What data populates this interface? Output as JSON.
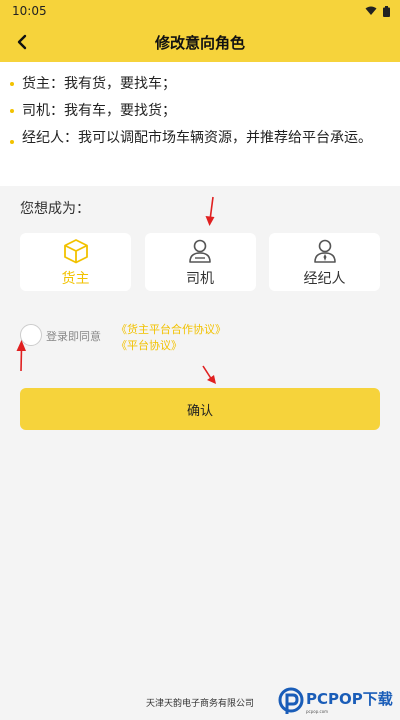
{
  "status_bar": {
    "time": "10:05"
  },
  "header": {
    "title": "修改意向角色"
  },
  "roles_info": [
    {
      "text": "货主：我有货，要找车；"
    },
    {
      "text": "司机：我有车，要找货；"
    },
    {
      "text": "经纪人：我可以调配市场车辆资源，并推荐给平台承运。"
    }
  ],
  "question": "您想成为：",
  "role_options": [
    {
      "label": "货主",
      "icon": "box-icon",
      "selected": true
    },
    {
      "label": "司机",
      "icon": "driver-icon",
      "selected": false
    },
    {
      "label": "经纪人",
      "icon": "agent-icon",
      "selected": false
    }
  ],
  "agreement": {
    "prefix": "登录即同意",
    "links": [
      "《货主平台合作协议》",
      "《平台协议》"
    ]
  },
  "confirm_label": "确认",
  "footer": {
    "company": "天津天韵电子商务有限公司"
  },
  "watermark": {
    "text": "PCPOP下载",
    "sub": "pcpop.com"
  },
  "colors": {
    "accent": "#f6d33b",
    "accent_text": "#f2c200",
    "annotation_arrow": "#e02020"
  }
}
